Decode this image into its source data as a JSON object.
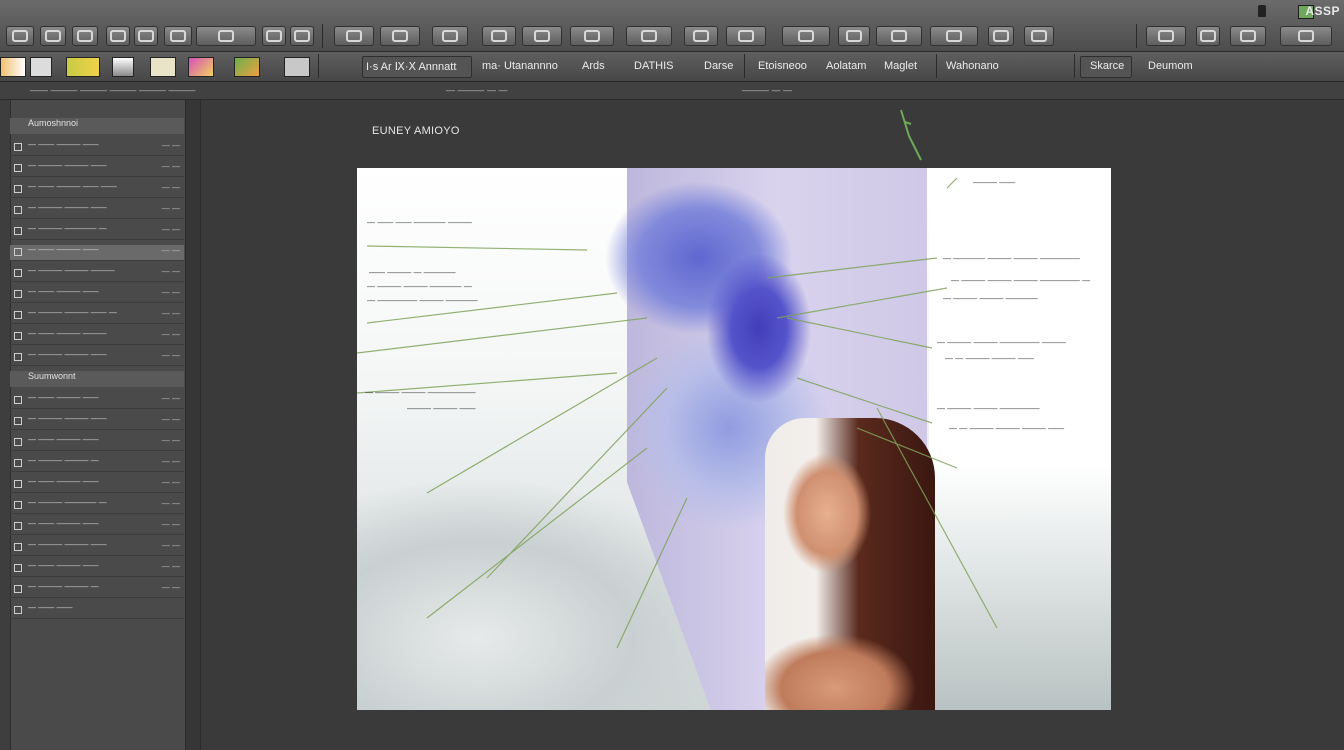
{
  "window": {
    "corner_label": "ASSP",
    "doc_title": "EUNEY AMIOYO"
  },
  "format_bar": {
    "labels": [
      "I·s Ar Ⅸ·Ⅹ Annnatt",
      "ma· Utanannno",
      "Ards",
      "DATHIS",
      "Darse",
      "Etoisneoo",
      "Aolatam",
      "Maglet",
      "Wahonano",
      "Skarce",
      "Deumom"
    ]
  },
  "ruler": {
    "left_text": "—— ——— ——— ——— ——— ———",
    "mid_text": "— ——— — —",
    "right_text": "——— — —"
  },
  "layers_panel": {
    "rows": [
      {
        "label": "Aumoshnnoi",
        "value": "",
        "kind": "header"
      },
      {
        "label": "— —— ——— ——",
        "value": "— —"
      },
      {
        "label": "— ——— ——— ——",
        "value": "— —"
      },
      {
        "label": "— —— ——— —— ——",
        "value": "— —"
      },
      {
        "label": "— ——— ——— ——",
        "value": "— —"
      },
      {
        "label": "— ——— ———— —",
        "value": "— —"
      },
      {
        "label": "— —— ——— ——",
        "value": "— —",
        "selected": true
      },
      {
        "label": "— ——— ——— ———",
        "value": "— —"
      },
      {
        "label": "— —— ——— ——",
        "value": "— —"
      },
      {
        "label": "— ——— ——— —— —",
        "value": "— —"
      },
      {
        "label": "— —— ——— ———",
        "value": "— —"
      },
      {
        "label": "— ——— ——— ——",
        "value": "— —"
      },
      {
        "label": "Suumwonnt",
        "value": "",
        "kind": "header"
      },
      {
        "label": "— —— ——— ——",
        "value": "— —"
      },
      {
        "label": "— ——— ——— ——",
        "value": "— —"
      },
      {
        "label": "— —— ——— ——",
        "value": "— —"
      },
      {
        "label": "— ——— ——— —",
        "value": "— —"
      },
      {
        "label": "— —— ——— ——",
        "value": "— —"
      },
      {
        "label": "— ——— ———— —",
        "value": "— —"
      },
      {
        "label": "— —— ——— ——",
        "value": "— —"
      },
      {
        "label": "— ——— ——— ——",
        "value": "— —"
      },
      {
        "label": "— —— ——— ——",
        "value": "— —"
      },
      {
        "label": "— ——— ——— —",
        "value": "— —"
      },
      {
        "label": "— —— ——",
        "value": ""
      }
    ]
  },
  "artboard": {
    "callouts_left": [
      "— —— —— ———— ———",
      "—— ——— — ————",
      "— ——— ——— ———— —",
      "— ————— ——— ————",
      "— ——— ——— ——————",
      "——— ——— ——"
    ],
    "callouts_right": [
      "——— ——",
      "— ———— ——— ——— —————",
      "— ——— ——— ——— ————— —",
      "— ——— ——— ————",
      "— ——— ——— ————— ———",
      "— — ——— ——— ——",
      "— ——— ——— —————",
      "— — ——— ——— ——— ——"
    ]
  },
  "colors": {
    "accent_green": "#6fa85a",
    "splash_blue": "#4f4ec9",
    "panel_bg": "#4a4a4a"
  }
}
